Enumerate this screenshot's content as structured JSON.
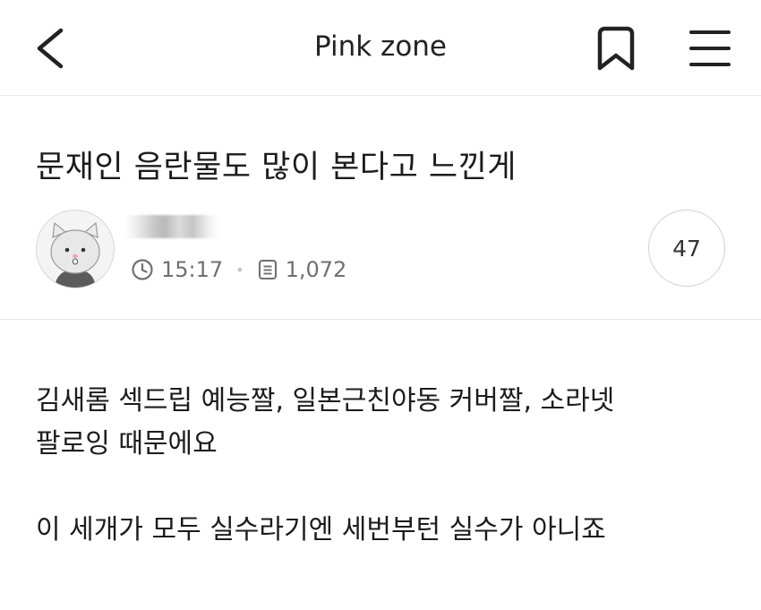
{
  "header": {
    "title": "Pink zone",
    "icons": {
      "back": "chevron-left-icon",
      "bookmark": "bookmark-icon",
      "menu": "hamburger-menu-icon"
    }
  },
  "post": {
    "title": "문재인 음란물도 많이 본다고 느낀게",
    "author": {
      "avatar_icon": "cat-avatar-icon"
    },
    "time": "15:17",
    "views": "1,072",
    "comment_count": "47",
    "body": {
      "line1": "김새롬 섹드립 예능짤, 일본근친야동 커버짤, 소라넷",
      "line2": "팔로잉 때문에요",
      "line3": "이 세개가 모두 실수라기엔 세번부턴 실수가 아니죠"
    }
  }
}
